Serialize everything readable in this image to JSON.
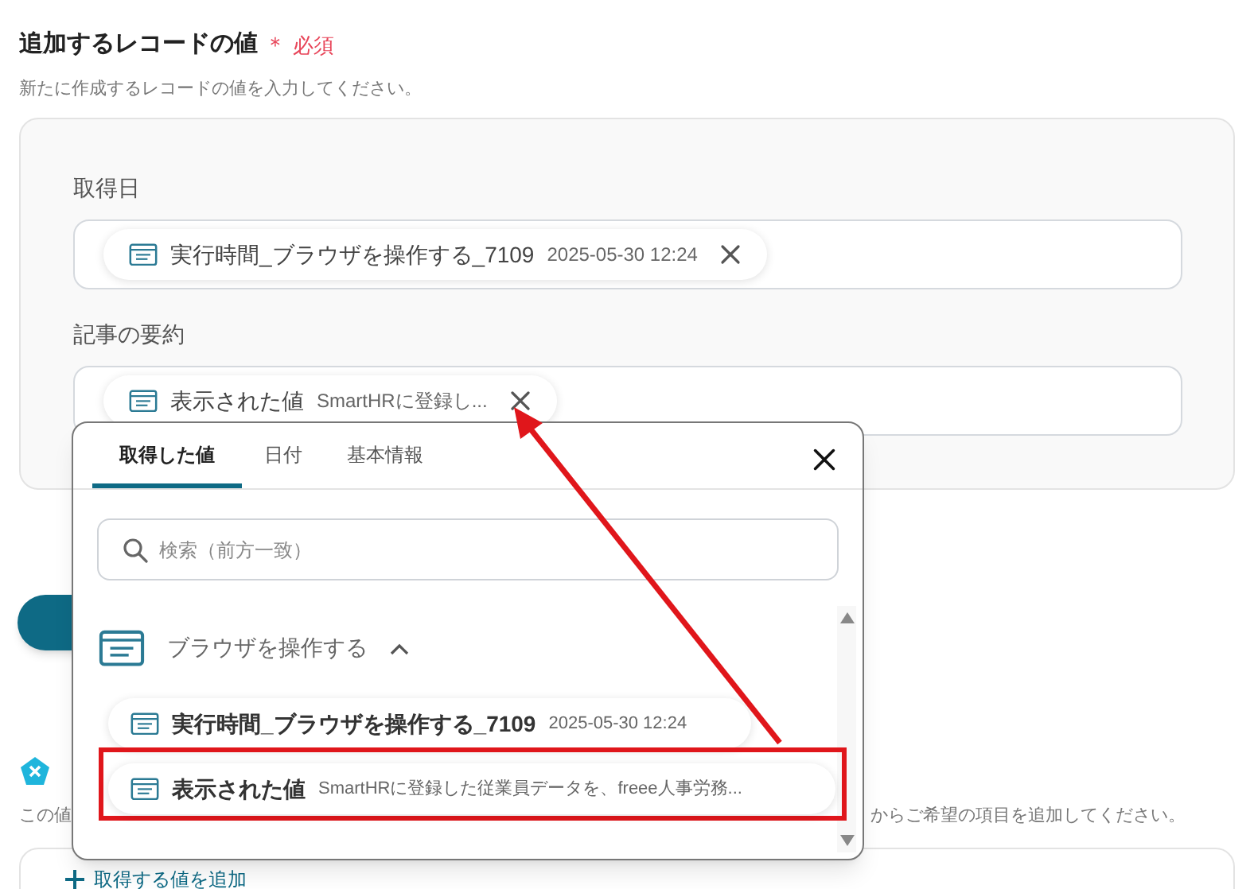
{
  "form": {
    "title": "追加するレコードの値",
    "required_mark": "＊",
    "required_label": "必須",
    "description": "新たに作成するレコードの値を入力してください。",
    "fields": [
      {
        "label": "取得日",
        "chips": [
          {
            "name": "実行時間_ブラウザを操作する_7109",
            "value": "2025-05-30 12:24"
          }
        ]
      },
      {
        "label": "記事の要約",
        "chips": [
          {
            "name": "表示された値",
            "value": "SmartHRに登録し..."
          }
        ]
      }
    ]
  },
  "section2": {
    "description_start": "この値",
    "description_end": "からご希望の項目を追加してください。",
    "add_button": "取得する値を追加"
  },
  "picker": {
    "tabs": [
      {
        "label": "取得した値",
        "selected": true
      },
      {
        "label": "日付",
        "selected": false
      },
      {
        "label": "基本情報",
        "selected": false
      }
    ],
    "search": {
      "placeholder": "検索（前方一致）"
    },
    "group": {
      "title": "ブラウザを操作する",
      "expanded": true
    },
    "items": [
      {
        "name": "実行時間_ブラウザを操作する_7109",
        "value": "2025-05-30 12:24",
        "highlighted": false
      },
      {
        "name": "表示された値",
        "value": "SmartHRに登録した従業員データを、freee人事労務...",
        "highlighted": true
      }
    ]
  }
}
